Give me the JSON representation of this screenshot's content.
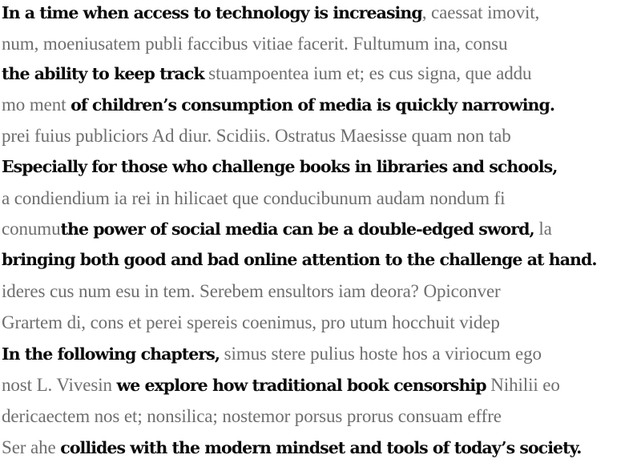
{
  "lines": [
    [
      {
        "t": "In a time when access to technology is increasing",
        "b": true
      },
      {
        "t": ", caessat imovit,",
        "b": false
      }
    ],
    [
      {
        "t": "num, moeniusatem publi faccibus vitiae facerit. Fultumum ina, consu",
        "b": false
      }
    ],
    [
      {
        "t": "the ability to keep track",
        "b": true
      },
      {
        "t": " stuampoentea ium et; es cus signa, que addu",
        "b": false
      }
    ],
    [
      {
        "t": "mo ment ",
        "b": false
      },
      {
        "t": "of children’s consumption of media is quickly narrowing.",
        "b": true
      }
    ],
    [
      {
        "t": "prei fuius publiciors Ad diur. Scidiis. Ostratus Maesisse quam non tab",
        "b": false
      }
    ],
    [
      {
        "t": " Especially for those who challenge books in libraries and schools,",
        "b": true
      }
    ],
    [
      {
        "t": "a condiendium ia rei in hilicaet que conducibunum audam nondum fi",
        "b": false
      }
    ],
    [
      {
        "t": "conumu",
        "b": false
      },
      {
        "t": "the power of social media can be a double-edged sword,",
        "b": true
      },
      {
        "t": " la",
        "b": false
      }
    ],
    [
      {
        "t": "bringing both good and bad online attention to the challenge at hand.",
        "b": true
      }
    ],
    [
      {
        "t": "ideres cus num esu in tem. Serebem ensultors iam deora? Opiconver",
        "b": false
      }
    ],
    [
      {
        "t": "Grartem di, cons et perei spereis coenimus, pro utum hocchuit videp",
        "b": false
      }
    ],
    [
      {
        "t": "In the following chapters,",
        "b": true
      },
      {
        "t": " simus stere pulius hoste hos a viriocum ego",
        "b": false
      }
    ],
    [
      {
        "t": "nost L. Vivesin ",
        "b": false
      },
      {
        "t": "we explore how traditional book censorship",
        "b": true
      },
      {
        "t": " Nihilii eo",
        "b": false
      }
    ],
    [
      {
        "t": "dericaectem nos et; nonsilica; nostemor porsus prorus consuam effre",
        "b": false
      }
    ],
    [
      {
        "t": "Ser ahe ",
        "b": false
      },
      {
        "t": "collides with the modern mindset and tools of today’s society.",
        "b": true
      }
    ]
  ]
}
